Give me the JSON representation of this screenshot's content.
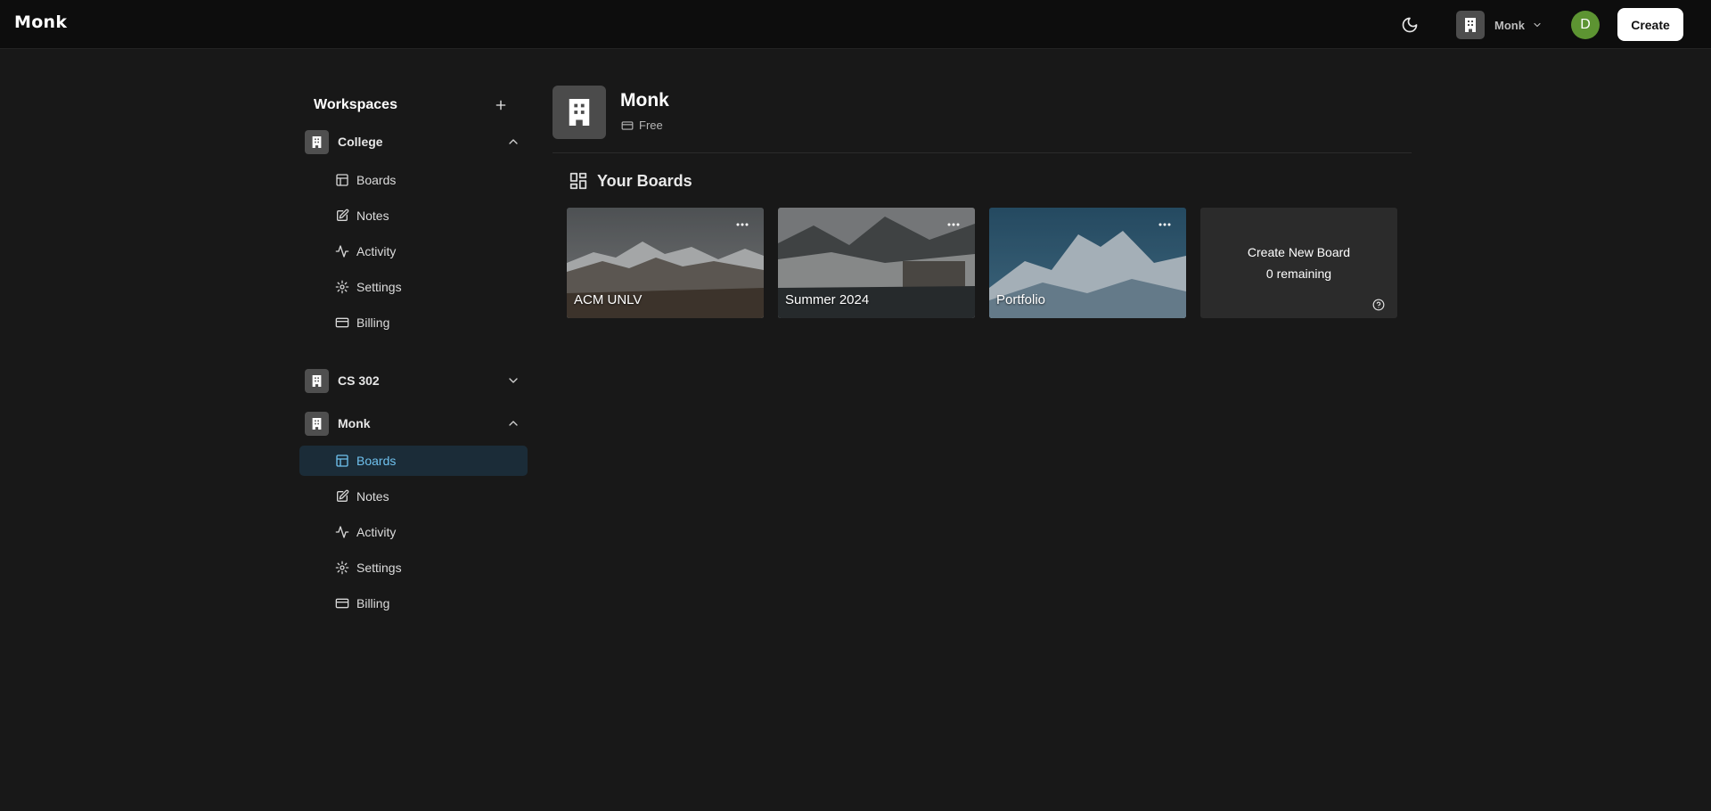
{
  "app": {
    "logo": "Monk"
  },
  "topbar": {
    "theme_icon": "moon-icon",
    "org_switcher": {
      "name": "Monk",
      "icon": "building-icon"
    },
    "avatar_initial": "D",
    "avatar_color": "#5d9432",
    "create_label": "Create"
  },
  "sidebar": {
    "title": "Workspaces",
    "add_icon": "plus-icon",
    "orgs": [
      {
        "name": "College",
        "expanded": true,
        "items": [
          {
            "label": "Boards",
            "icon": "layout-icon"
          },
          {
            "label": "Notes",
            "icon": "note-edit-icon"
          },
          {
            "label": "Activity",
            "icon": "activity-icon"
          },
          {
            "label": "Settings",
            "icon": "gear-icon"
          },
          {
            "label": "Billing",
            "icon": "credit-card-icon"
          }
        ]
      },
      {
        "name": "CS 302",
        "expanded": false,
        "items": []
      },
      {
        "name": "Monk",
        "expanded": true,
        "items": [
          {
            "label": "Boards",
            "icon": "layout-icon",
            "active": true
          },
          {
            "label": "Notes",
            "icon": "note-edit-icon"
          },
          {
            "label": "Activity",
            "icon": "activity-icon"
          },
          {
            "label": "Settings",
            "icon": "gear-icon"
          },
          {
            "label": "Billing",
            "icon": "credit-card-icon"
          }
        ]
      }
    ]
  },
  "main": {
    "org_name": "Monk",
    "plan": "Free",
    "boards_heading": "Your Boards",
    "boards": [
      {
        "title": "ACM UNLV"
      },
      {
        "title": "Summer 2024"
      },
      {
        "title": "Portfolio"
      }
    ],
    "create_card": {
      "title": "Create New Board",
      "remaining": "0 remaining"
    }
  },
  "colors": {
    "background": "#181818",
    "topbar": "#0d0d0d",
    "active_nav_bg": "#1b2c38",
    "active_nav_text": "#6fc1ee",
    "accent_avatar": "#5d9432"
  }
}
